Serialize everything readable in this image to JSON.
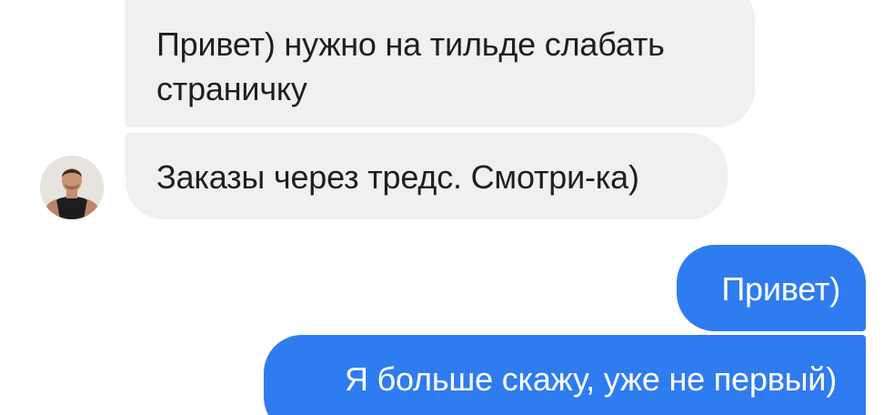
{
  "messages": [
    {
      "direction": "incoming",
      "text": "Привет) нужно на тильде слабать страничку"
    },
    {
      "direction": "incoming",
      "text": "Заказы через тредс. Смотри-ка)"
    },
    {
      "direction": "outgoing",
      "text": "Привет)"
    },
    {
      "direction": "outgoing",
      "text": "Я больше скажу, уже не первый)"
    }
  ],
  "colors": {
    "incoming_bubble": "#f0f0f0",
    "incoming_text": "#1f1f1f",
    "outgoing_bubble": "#2f7cf0",
    "outgoing_text": "#ffffff",
    "background": "#ffffff"
  },
  "avatar": {
    "icon": "user-avatar-photo"
  }
}
